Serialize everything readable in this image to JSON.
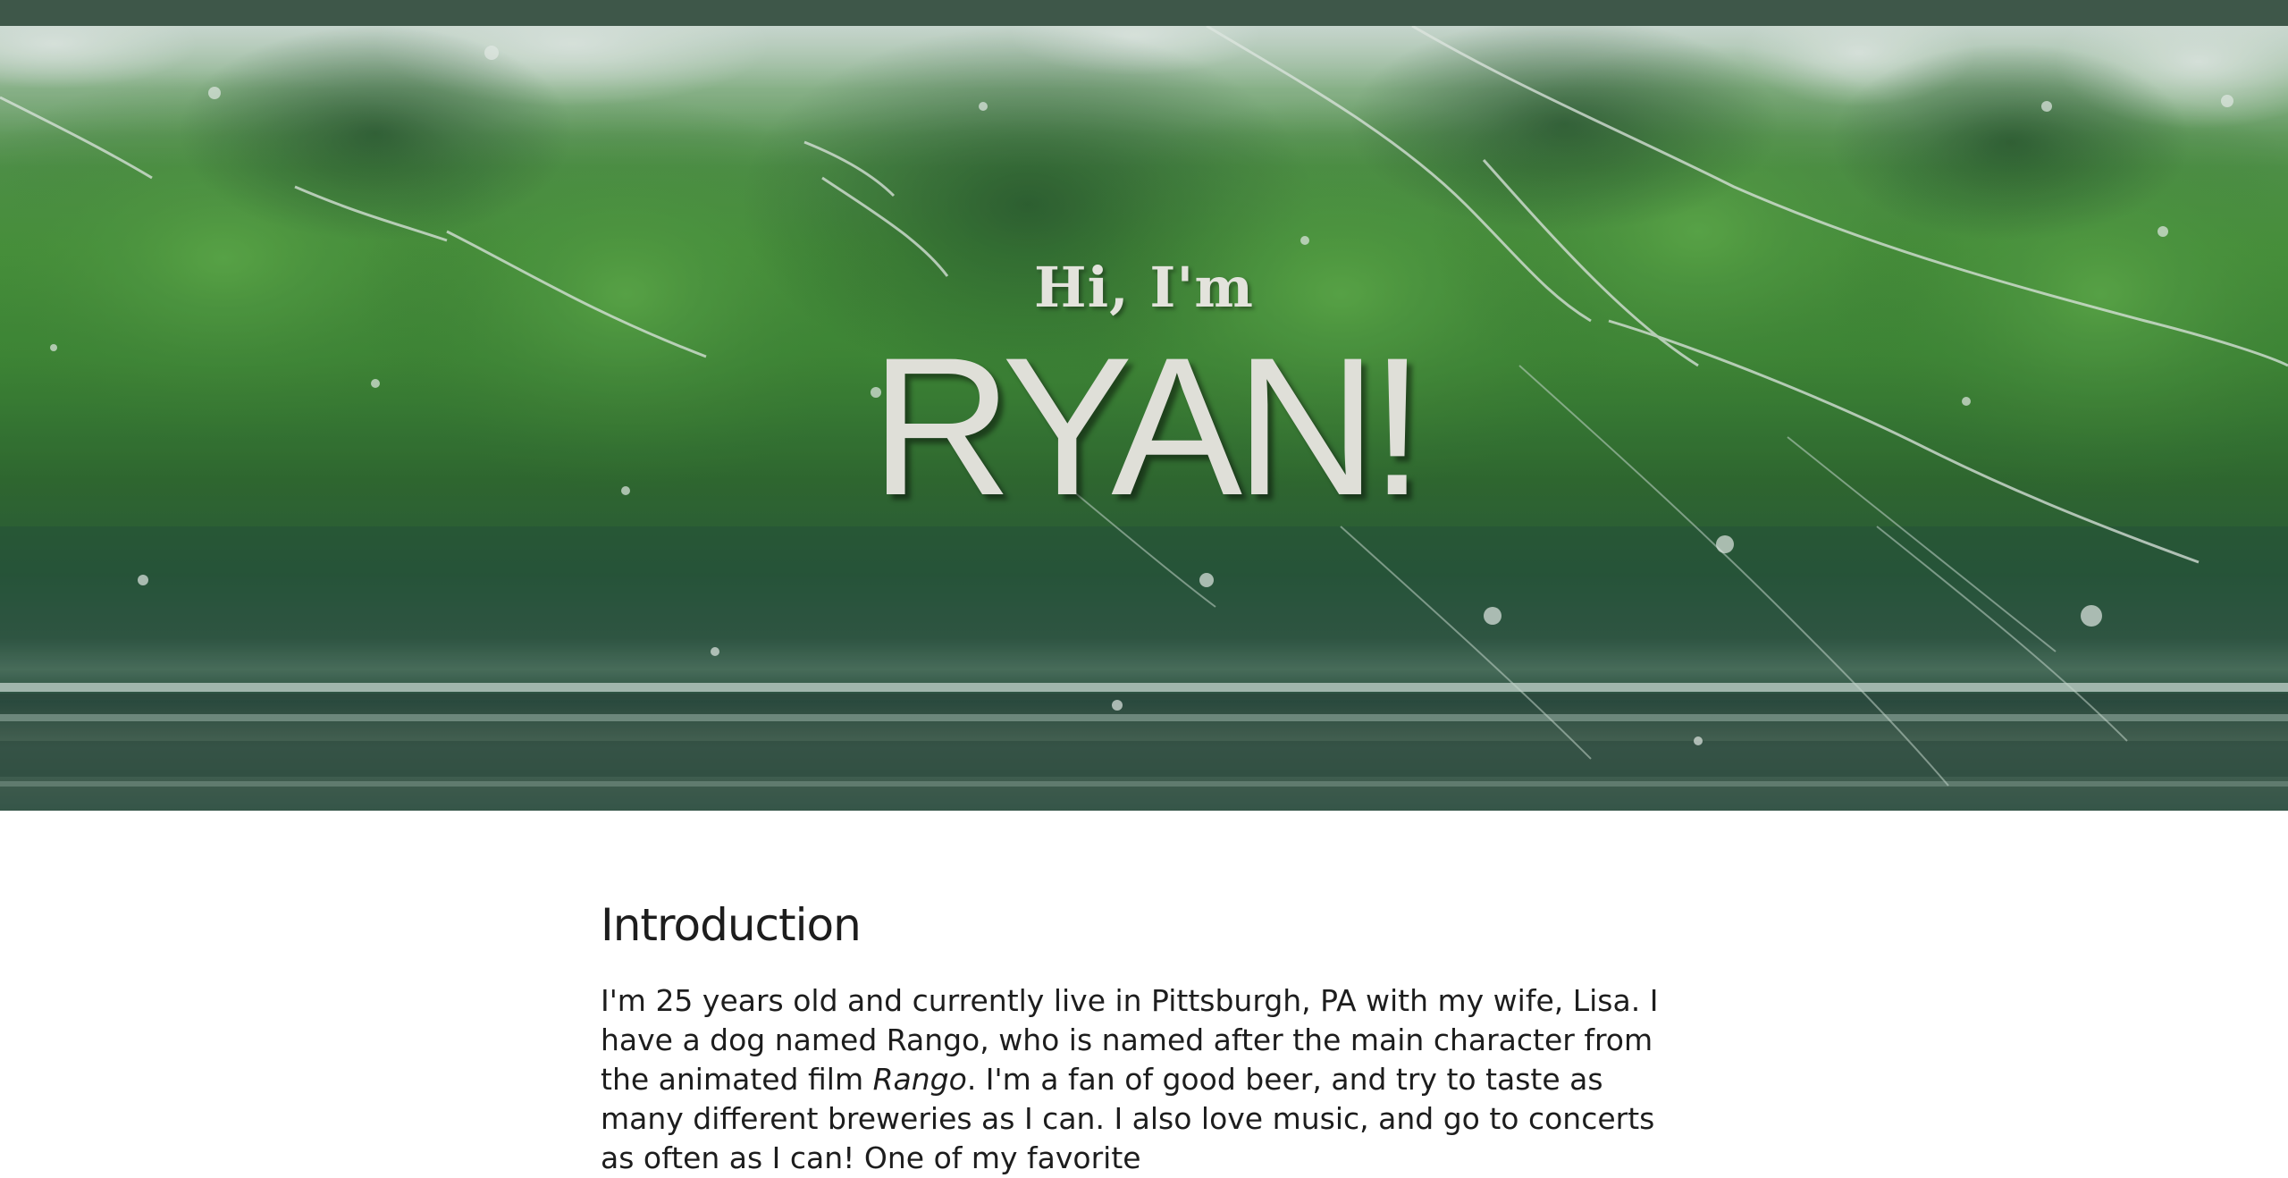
{
  "hero": {
    "greeting": "Hi, I'm",
    "name": "RYAN!"
  },
  "introduction": {
    "heading": "Introduction",
    "body_part1": "I'm 25 years old and currently live in Pittsburgh, PA with my wife, Lisa. I have a dog named Rango, who is named after the main character from the animated film ",
    "body_film": "Rango",
    "body_part2": ". I'm a fan of good beer, and try to taste as many different breweries as I can. I also love music, and go to concerts as often as I can! One of my favorite"
  },
  "colors": {
    "top_bar": "#3e5749",
    "hero_text": "#e3e3dc",
    "body_text": "#1d1d1d"
  }
}
